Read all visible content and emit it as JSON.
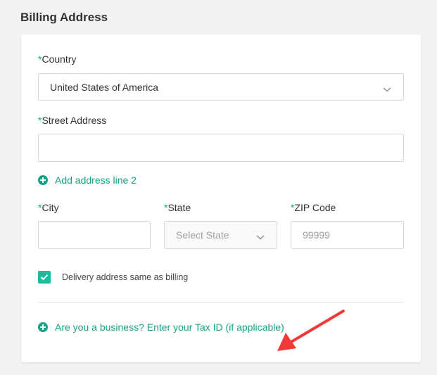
{
  "section": {
    "title": "Billing Address"
  },
  "form": {
    "required_marker": "*",
    "country": {
      "label": "Country",
      "value": "United States of America"
    },
    "street": {
      "label": "Street Address",
      "value": ""
    },
    "add_line2": {
      "label": "Add address line 2"
    },
    "city": {
      "label": "City",
      "value": ""
    },
    "state": {
      "label": "State",
      "placeholder": "Select State"
    },
    "zip": {
      "label": "ZIP Code",
      "placeholder": "99999"
    },
    "delivery_same": {
      "label": "Delivery address same as billing",
      "checked": true
    },
    "tax_id": {
      "label": "Are you a business? Enter your Tax ID (if applicable)"
    }
  },
  "icons": {
    "dropdown": "chevron-down-icon",
    "add": "plus-circle-icon",
    "check": "check-icon",
    "annotation": "red-arrow-icon"
  },
  "colors": {
    "accent": "#16a085",
    "checkbox": "#1abc9c",
    "annotation_arrow": "#f03a3a",
    "background": "#f2f2f2",
    "card": "#ffffff"
  }
}
